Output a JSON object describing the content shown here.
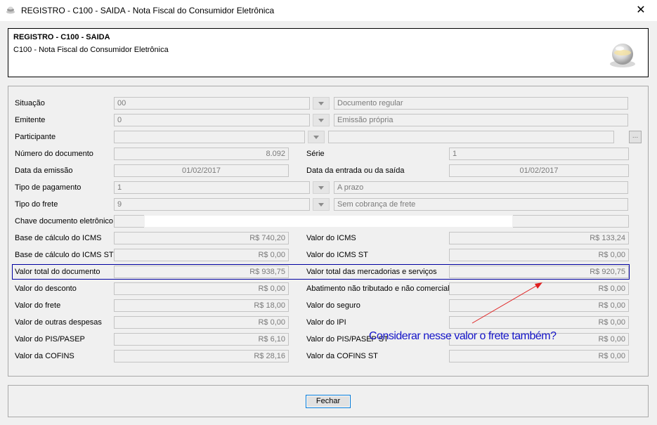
{
  "window": {
    "title": "REGISTRO - C100 - SAIDA",
    "subtitle": "Nota Fiscal do Consumidor Eletrônica",
    "title_full": "REGISTRO - C100 - SAIDA - Nota Fiscal do Consumidor Eletrônica",
    "close_glyph": "✕"
  },
  "header": {
    "title": "REGISTRO - C100 - SAIDA",
    "description": "C100 - Nota Fiscal do Consumidor Eletrônica"
  },
  "form": {
    "situacao": {
      "label": "Situação",
      "code": "00",
      "desc": "Documento regular"
    },
    "emitente": {
      "label": "Emitente",
      "code": "0",
      "desc": "Emissão própria"
    },
    "participante": {
      "label": "Participante",
      "code": "",
      "desc": "",
      "button": "..."
    },
    "numero": {
      "label": "Número do documento",
      "value": "8.092"
    },
    "serie": {
      "label": "Série",
      "value": "1"
    },
    "data_emissao": {
      "label": "Data da emissão",
      "value": "01/02/2017"
    },
    "data_entrada": {
      "label": "Data da entrada ou da saída",
      "value": "01/02/2017"
    },
    "tipo_pagamento": {
      "label": "Tipo de pagamento",
      "code": "1",
      "desc": "A prazo"
    },
    "tipo_frete": {
      "label": "Tipo do frete",
      "code": "9",
      "desc": "Sem cobrança de frete"
    },
    "chave": {
      "label": "Chave documento eletrônico",
      "value": ""
    },
    "base_icms": {
      "label": "Base de cálculo do ICMS",
      "value": "R$ 740,20"
    },
    "valor_icms": {
      "label": "Valor do ICMS",
      "value": "R$ 133,24"
    },
    "base_icms_st": {
      "label": "Base de cálculo do ICMS ST",
      "value": "R$ 0,00"
    },
    "valor_icms_st": {
      "label": "Valor do ICMS ST",
      "value": "R$ 0,00"
    },
    "valor_total_doc": {
      "label": "Valor total do documento",
      "value": "R$ 938,75"
    },
    "valor_total_merc": {
      "label": "Valor total das mercadorias e serviços",
      "value": "R$ 920,75"
    },
    "valor_desconto": {
      "label": "Valor do desconto",
      "value": "R$ 0,00"
    },
    "abatimento": {
      "label": "Abatimento não tributado e não comercial",
      "value": "R$ 0,00"
    },
    "valor_frete": {
      "label": "Valor do frete",
      "value": "R$ 18,00"
    },
    "valor_seguro": {
      "label": "Valor do seguro",
      "value": "R$ 0,00"
    },
    "outras_despesas": {
      "label": "Valor de outras despesas",
      "value": "R$ 0,00"
    },
    "valor_ipi": {
      "label": "Valor do IPI",
      "value": "R$ 0,00"
    },
    "pis_pasep": {
      "label": "Valor do PIS/PASEP",
      "value": "R$ 6,10"
    },
    "pis_pasep_st": {
      "label": "Valor do PIS/PASEP ST",
      "value": "R$ 0,00"
    },
    "cofins": {
      "label": "Valor da COFINS",
      "value": "R$ 28,16"
    },
    "cofins_st": {
      "label": "Valor da COFINS ST",
      "value": "R$ 0,00"
    }
  },
  "annotation": {
    "text": "Considerar nesse valor o frete também?",
    "color": "#1414c8",
    "arrow_color": "#e02020",
    "box_color": "#0000a0"
  },
  "footer": {
    "close_label": "Fechar"
  }
}
